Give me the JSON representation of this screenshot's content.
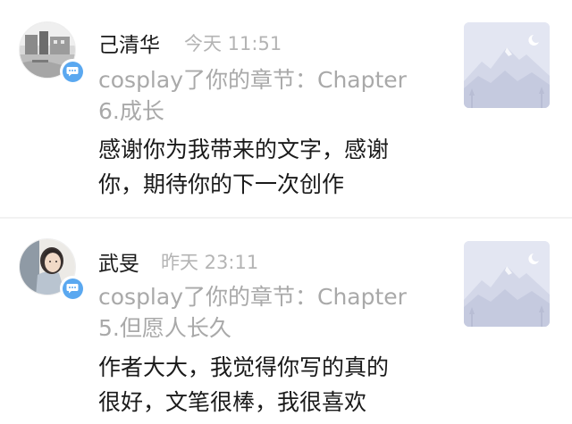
{
  "comments": [
    {
      "user_name": "己清华",
      "time": "今天 11:51",
      "reference_line1": "cosplay了你的章节：Chapter",
      "reference_line2": "6.成长",
      "message_line1": "感谢你为我带来的文字，感谢",
      "message_line2": "你，期待你的下一次创作",
      "avatar_icon": "landscape-avatar",
      "badge_icon": "chat-bubble-icon",
      "thumbnail_icon": "mountain-placeholder-icon"
    },
    {
      "user_name": "武旻",
      "time": "昨天 23:11",
      "reference_line1": "cosplay了你的章节：Chapter",
      "reference_line2": "5.但愿人长久",
      "message_line1": "作者大大，我觉得你写的真的",
      "message_line2": "很好，文笔很棒，我很喜欢",
      "avatar_icon": "person-avatar",
      "badge_icon": "chat-bubble-icon",
      "thumbnail_icon": "mountain-placeholder-icon"
    }
  ],
  "colors": {
    "badge": "#5aa8f0",
    "time_text": "#b4b4b4",
    "reference_text": "#a9a9a9",
    "thumbnail_bg": "#e3e6f2"
  }
}
